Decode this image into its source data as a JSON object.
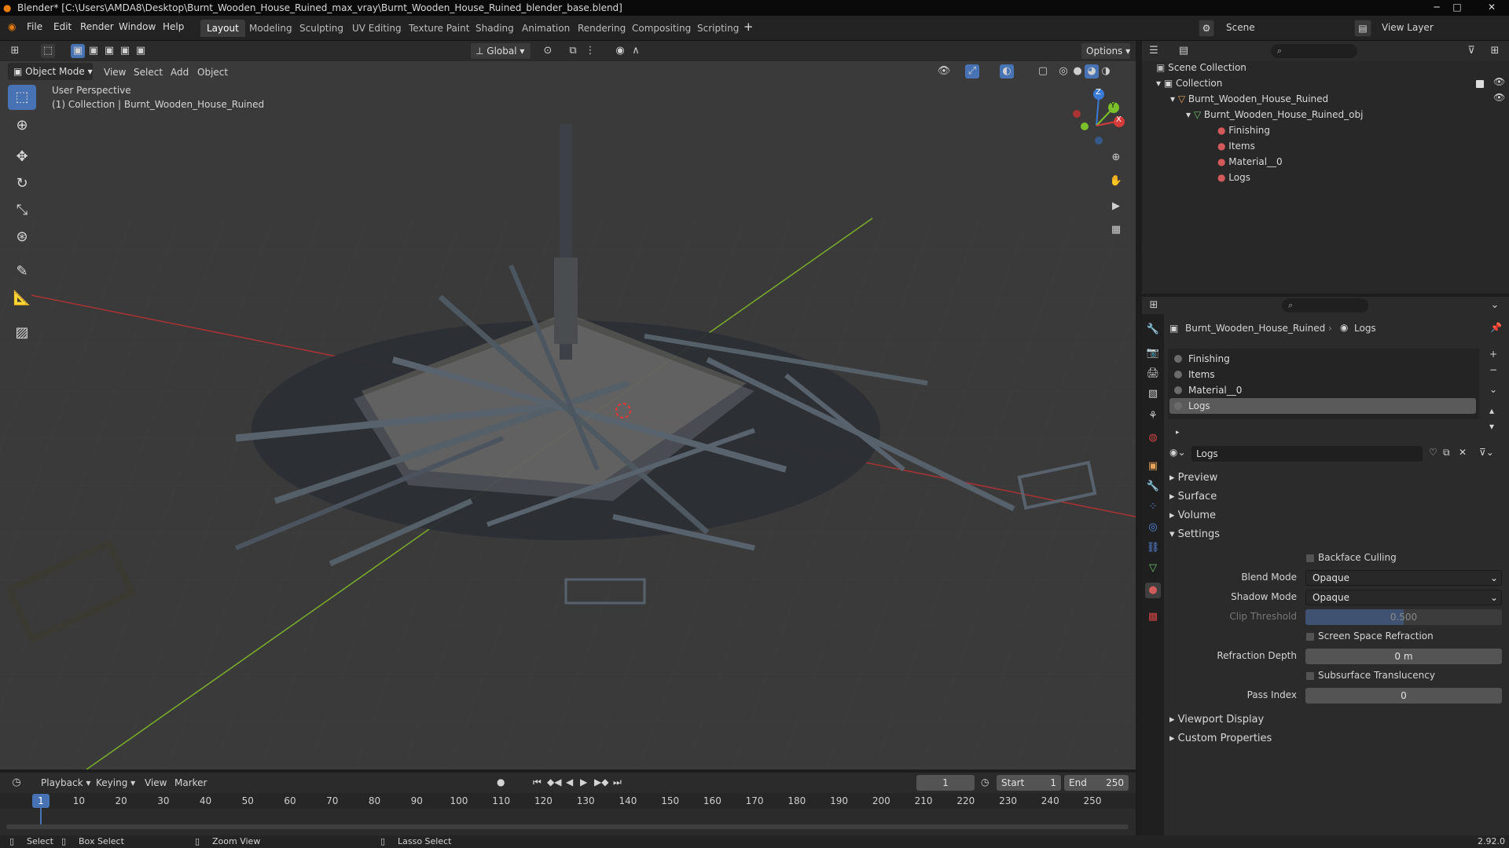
{
  "window": {
    "title": "Blender* [C:\\Users\\AMDA8\\Desktop\\Burnt_Wooden_House_Ruined_max_vray\\Burnt_Wooden_House_Ruined_blender_base.blend]",
    "controls": [
      "─",
      "□",
      "✕"
    ]
  },
  "menubar": {
    "menus": [
      "File",
      "Edit",
      "Render",
      "Window",
      "Help"
    ],
    "workspaces": [
      "Layout",
      "Modeling",
      "Sculpting",
      "UV Editing",
      "Texture Paint",
      "Shading",
      "Animation",
      "Rendering",
      "Compositing",
      "Scripting"
    ],
    "active_workspace": "Layout",
    "add_workspace": "+",
    "scene_label": "Scene",
    "view_layer_label": "View Layer"
  },
  "viewport": {
    "header": {
      "mode": "Object Mode",
      "menus": [
        "View",
        "Select",
        "Add",
        "Object"
      ],
      "orientation": "Global",
      "options": "Options"
    },
    "overlay_text": {
      "line1": "User Perspective",
      "line2": "(1) Collection | Burnt_Wooden_House_Ruined"
    },
    "gizmo": {
      "x": "X",
      "y": "Y",
      "z": "Z"
    },
    "tools": [
      "select-box-icon",
      "cursor-icon",
      "move-icon",
      "rotate-icon",
      "scale-icon",
      "transform-icon",
      "annotate-icon",
      "measure-icon",
      "add-cube-icon"
    ]
  },
  "outliner": {
    "search_placeholder": "",
    "rows": [
      {
        "label": "Scene Collection"
      },
      {
        "label": "Collection"
      },
      {
        "label": "Burnt_Wooden_House_Ruined"
      },
      {
        "label": "Burnt_Wooden_House_Ruined_obj"
      },
      {
        "label": "Finishing"
      },
      {
        "label": "Items"
      },
      {
        "label": "Material__0"
      },
      {
        "label": "Logs"
      }
    ]
  },
  "properties": {
    "breadcrumb_object": "Burnt_Wooden_House_Ruined",
    "breadcrumb_material": "Logs",
    "slots": [
      "Finishing",
      "Items",
      "Material__0",
      "Logs"
    ],
    "active_slot": "Logs",
    "material_name": "Logs",
    "panels": {
      "preview": "Preview",
      "surface": "Surface",
      "volume": "Volume",
      "settings": "Settings",
      "viewport_display": "Viewport Display",
      "custom_properties": "Custom Properties"
    },
    "settings": {
      "backface_culling": "Backface Culling",
      "blend_mode_label": "Blend Mode",
      "blend_mode_value": "Opaque",
      "shadow_mode_label": "Shadow Mode",
      "shadow_mode_value": "Opaque",
      "clip_threshold_label": "Clip Threshold",
      "clip_threshold_value": "0.500",
      "ssr_label": "Screen Space Refraction",
      "refraction_depth_label": "Refraction Depth",
      "refraction_depth_value": "0 m",
      "subsurface_label": "Subsurface Translucency",
      "pass_index_label": "Pass Index",
      "pass_index_value": "0"
    }
  },
  "timeline": {
    "menus": [
      "Playback",
      "Keying",
      "View",
      "Marker"
    ],
    "current_frame": "1",
    "start_label": "Start",
    "start_value": "1",
    "end_label": "End",
    "end_value": "250",
    "ticks": [
      "1",
      "10",
      "20",
      "30",
      "40",
      "50",
      "60",
      "70",
      "80",
      "90",
      "100",
      "110",
      "120",
      "130",
      "140",
      "150",
      "160",
      "170",
      "180",
      "190",
      "200",
      "210",
      "220",
      "230",
      "240",
      "250"
    ]
  },
  "statusbar": {
    "select": "Select",
    "box_select": "Box Select",
    "zoom_view": "Zoom View",
    "lasso_select": "Lasso Select",
    "version": "2.92.0"
  },
  "colors": {
    "accent": "#4772b3",
    "x_axis": "#d63b3b",
    "y_axis": "#7bbf2a",
    "z_axis": "#3b7ad6"
  }
}
